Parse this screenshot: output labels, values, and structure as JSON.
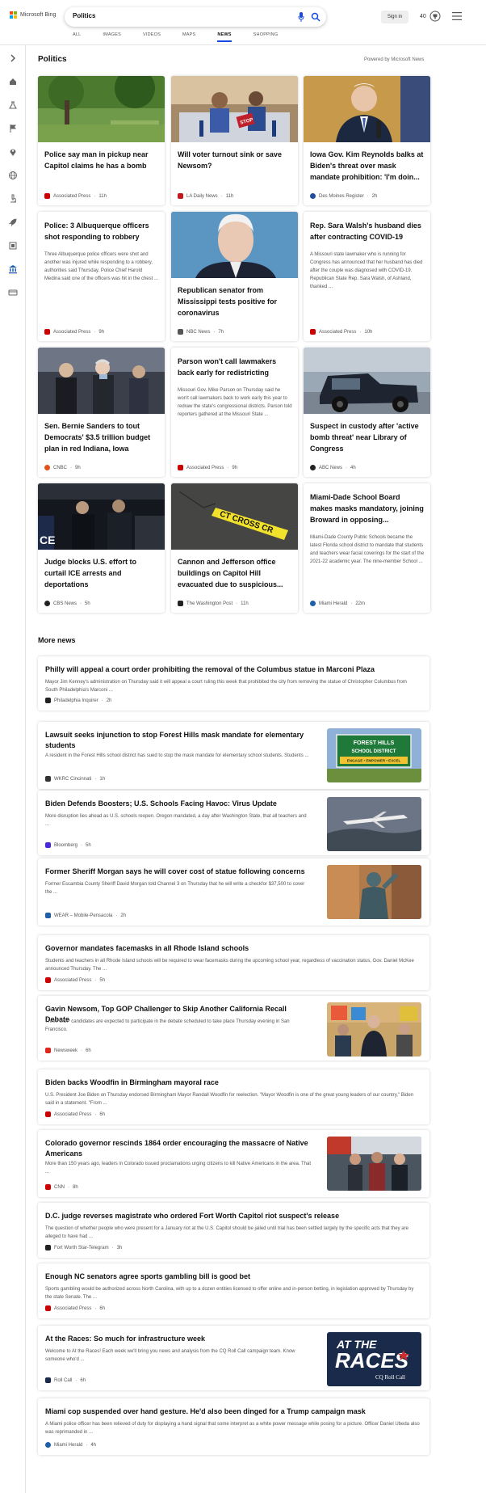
{
  "header": {
    "brand": "Microsoft Bing",
    "search_value": "Politics",
    "signin_label": "Sign in",
    "points": "40",
    "tabs": [
      {
        "label": "ALL"
      },
      {
        "label": "IMAGES"
      },
      {
        "label": "VIDEOS"
      },
      {
        "label": "MAPS"
      },
      {
        "label": "NEWS"
      },
      {
        "label": "SHOPPING"
      }
    ],
    "active_tab": "NEWS",
    "accent": "#174ae4"
  },
  "sidebar": {
    "icons": [
      "chevron-right-icon",
      "home-icon",
      "flask-icon",
      "flag-icon",
      "pin-icon",
      "globe-icon",
      "microscope-icon",
      "rocket-icon",
      "film-icon",
      "bank-icon",
      "card-icon"
    ],
    "active": "bank-icon"
  },
  "section": {
    "title": "Politics",
    "powered": "Powered by Microsoft News"
  },
  "cards": [
    {
      "title": "Police say man in pickup near Capitol claims he has a bomb",
      "snippet": "",
      "source": "Associated Press",
      "time": "11h",
      "logo_color": "#cc0000"
    },
    {
      "title": "Will voter turnout sink or save Newsom?",
      "snippet": "",
      "source": "LA Daily News",
      "time": "11h",
      "logo_color": "#c4161c"
    },
    {
      "title": "Iowa Gov. Kim Reynolds balks at Biden's threat over mask mandate prohibition: 'I'm doin...",
      "snippet": "",
      "source": "Des Moines Register",
      "time": "2h",
      "logo_color": "#1f4e9c"
    },
    {
      "title": "Police: 3 Albuquerque officers shot responding to robbery",
      "snippet": "Three Albuquerque police officers were shot and another was injured while responding to a robbery, authorities said Thursday. Police Chief Harold Medina said one of the officers was hit in the chest ...",
      "source": "Associated Press",
      "time": "9h",
      "logo_color": "#cc0000"
    },
    {
      "title": "Republican senator from Mississippi tests positive for coronavirus",
      "snippet": "",
      "source": "NBC News",
      "time": "7h",
      "logo_color": "#555555"
    },
    {
      "title": "Rep. Sara Walsh's husband dies after contracting COVID-19",
      "snippet": "A Missouri state lawmaker who is running for Congress has announced that her husband has died after the couple was diagnosed with COVID-19. Republican State Rep. Sara Walsh, of Ashland, thanked ...",
      "source": "Associated Press",
      "time": "10h",
      "logo_color": "#cc0000"
    },
    {
      "title": "Sen. Bernie Sanders to tout Democrats' $3.5 trillion budget plan in red Indiana, Iowa",
      "snippet": "",
      "source": "CNBC",
      "time": "9h",
      "logo_color": "#e2541b"
    },
    {
      "title": "Parson won't call lawmakers back early for redistricting",
      "snippet": "Missouri Gov. Mike Parson on Thursday said he won't call lawmakers back to work early this year to redraw the state's congressional districts. Parson told reporters gathered at the Missouri State ...",
      "source": "Associated Press",
      "time": "9h",
      "logo_color": "#cc0000"
    },
    {
      "title": "Suspect in custody after 'active bomb threat' near Library of Congress",
      "snippet": "",
      "source": "ABC News",
      "time": "4h",
      "logo_color": "#222222"
    },
    {
      "title": "Judge blocks U.S. effort to curtail ICE arrests and deportations",
      "snippet": "",
      "source": "CBS News",
      "time": "5h",
      "logo_color": "#222222"
    },
    {
      "title": "Cannon and Jefferson office buildings on Capitol Hill evacuated due to suspicious...",
      "snippet": "",
      "source": "The Washington Post",
      "time": "11h",
      "logo_color": "#222222"
    },
    {
      "title": "Miami-Dade School Board makes masks mandatory, joining Broward in opposing...",
      "snippet": "Miami-Dade County Public Schools became the latest Florida school district to mandate that students and teachers wear facial coverings for the start of the 2021-22 academic year. The nine-member School ...",
      "source": "Miami Herald",
      "time": "22m",
      "logo_color": "#1f5fa8"
    }
  ],
  "more_news": {
    "title": "More news",
    "items": [
      {
        "title": "Philly will appeal a court order prohibiting the removal of the Columbus statue in Marconi Plaza",
        "snippet": "Mayor Jim Kenney's administration on Thursday said it will appeal a court ruling this week that prohibited the city from removing the statue of Christopher Columbus from South Philadelphia's Marconi ...",
        "source": "Philadelphia Inquirer",
        "time": "2h",
        "logo_color": "#222222"
      },
      {
        "title": "Lawsuit seeks injunction to stop Forest Hills mask mandate for elementary students",
        "snippet": "A resident in the Forest Hills school district has sued to stop the mask mandate for elementary school students. Students ...",
        "source": "WKRC Cincinnati",
        "time": "1h",
        "logo_color": "#333333",
        "sign_line1": "FOREST HILLS",
        "sign_line2": "SCHOOL DISTRICT",
        "sign_line3": "ENGAGE • EMPOWER • EXCEL"
      },
      {
        "title": "Biden Defends Boosters; U.S. Schools Facing Havoc: Virus Update",
        "snippet": "More disruption lies ahead as U.S. schools reopen. Oregon mandated, a day after Washington State, that all teachers and ...",
        "source": "Bloomberg",
        "time": "5h",
        "logo_color": "#4b2bd6"
      },
      {
        "title": "Former Sheriff Morgan says he will cover cost of statue following concerns",
        "snippet": "Former Escambia County Sheriff David Morgan told Channel 3 on Thursday that he will write a checkfor $37,500 to cover the ...",
        "source": "WEAR – Mobile-Pensacola",
        "time": "2h",
        "logo_color": "#1f5fa8"
      },
      {
        "title": "Governor mandates facemasks in all Rhode Island schools",
        "snippet": "Students and teachers in all Rhode Island schools will be required to wear facemasks during the upcoming school year, regardless of vaccination status, Gov. Daniel McKee announced Thursday. The ...",
        "source": "Associated Press",
        "time": "5h",
        "logo_color": "#cc0000"
      },
      {
        "title": "Gavin Newsom, Top GOP Challenger to Skip Another California Recall Debate",
        "snippet": "Three GOP candidates are expected to participate in the debate scheduled to take place Thursday evening in San Francisco.",
        "source": "Newsweek",
        "time": "6h",
        "logo_color": "#e0261d"
      },
      {
        "title": "Biden backs Woodfin in Birmingham mayoral race",
        "snippet": "U.S. President Joe Biden on Thursday endorsed Birmingham Mayor Randall Woodfin for reelection. \"Mayor Woodfin is one of the great young leaders of our country,\" Biden said in a statement. \"From ...",
        "source": "Associated Press",
        "time": "6h",
        "logo_color": "#cc0000"
      },
      {
        "title": "Colorado governor rescinds 1864 order encouraging the massacre of Native Americans",
        "snippet": "More than 150 years ago, leaders in Colorado issued proclamations urging citizens to kill Native Americans in the area. That ...",
        "source": "CNN",
        "time": "8h",
        "logo_color": "#cc0000"
      },
      {
        "title": "D.C. judge reverses magistrate who ordered Fort Worth Capitol riot suspect's release",
        "snippet": "The question of whether people who were present for a January riot at the U.S. Capitol should be jailed until trial has been settled largely by the specific acts that they are alleged to have had ...",
        "source": "Fort Worth Star-Telegram",
        "time": "3h",
        "logo_color": "#222222"
      },
      {
        "title": "Enough NC senators agree sports gambling bill is good bet",
        "snippet": "Sports gambling would be authorized across North Carolina, with up to a dozen entities licensed to offer online and in-person betting, in legislation approved by Thursday by the state Senate. The ...",
        "source": "Associated Press",
        "time": "6h",
        "logo_color": "#cc0000"
      },
      {
        "title": "At the Races: So much for infrastructure week",
        "snippet": "Welcome to At the Races! Each week we'll bring you news and analysis from the CQ Roll Call campaign team. Know someone who'd ...",
        "source": "Roll Call",
        "time": "6h",
        "logo_color": "#1a2a4a",
        "thumb_line1": "AT THE",
        "thumb_line2": "RACES",
        "thumb_line3": "CQ Roll Call"
      },
      {
        "title": "Miami cop suspended over hand gesture. He'd also been dinged for a Trump campaign mask",
        "snippet": "A Miami police officer has been relieved of duty for displaying a hand signal that some interpret as a white power message while posing for a picture. Officer Daniel Ubeda also was reprimanded in ...",
        "source": "Miami Herald",
        "time": "4h",
        "logo_color": "#1f5fa8"
      }
    ]
  },
  "image_texts": {
    "yellow_tape": "CT CROSS CR",
    "stop_sign": "STOP"
  }
}
